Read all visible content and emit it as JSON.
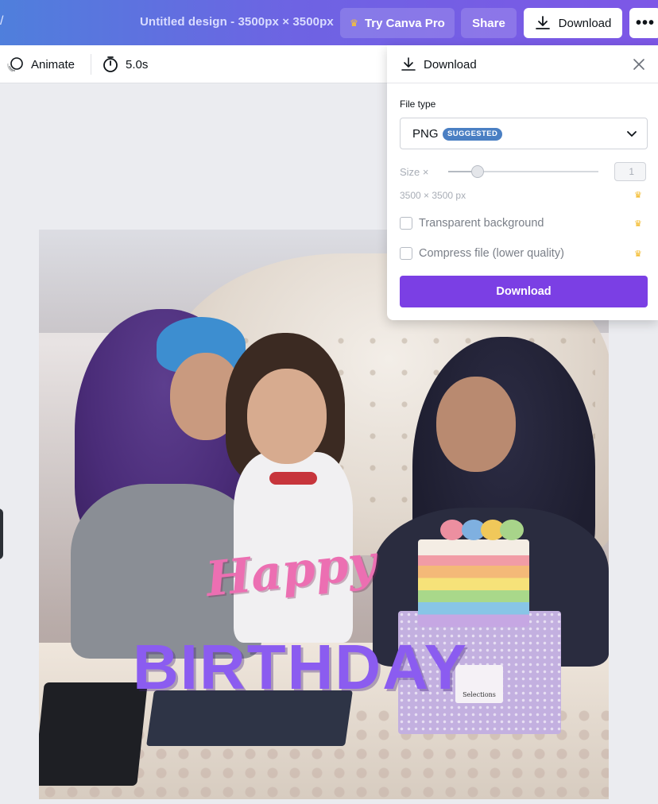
{
  "topbar": {
    "edge_mark": "/",
    "design_title": "Untitled design - 3500px × 3500px",
    "try_pro_label": "Try Canva Pro",
    "share_label": "Share",
    "download_label": "Download",
    "more_label": "•••",
    "gradient_start": "#4f7fdc",
    "gradient_end": "#7d57e6"
  },
  "toolbar": {
    "animate_label": "Animate",
    "duration_label": "5.0s"
  },
  "canvas": {
    "text_happy": "Happy",
    "text_birthday": "BIRTHDAY",
    "box_label": "Selections"
  },
  "download_panel": {
    "title": "Download",
    "file_type_label": "File type",
    "file_type_value": "PNG",
    "file_type_badge": "SUGGESTED",
    "size_label": "Size ×",
    "size_value": "1",
    "dimensions": "3500 × 3500 px",
    "transparent_label": "Transparent background",
    "compress_label": "Compress file (lower quality)",
    "download_button_label": "Download",
    "accent_color": "#7b3fe4",
    "pro_icon": "crown-icon"
  }
}
